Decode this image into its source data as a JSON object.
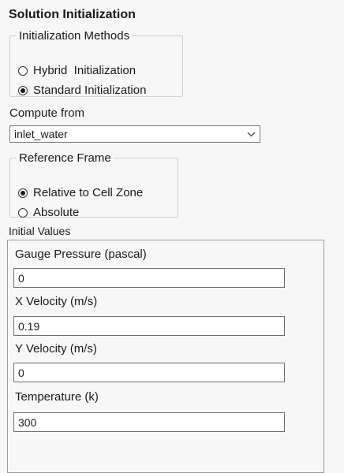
{
  "panel": {
    "title": "Solution Initialization"
  },
  "initialization_methods": {
    "legend": "Initialization Methods",
    "options": [
      {
        "label": "Hybrid  Initialization",
        "checked": false
      },
      {
        "label": "Standard Initialization",
        "checked": true
      }
    ]
  },
  "compute_from": {
    "label": "Compute from",
    "value": "inlet_water"
  },
  "reference_frame": {
    "legend": "Reference Frame",
    "options": [
      {
        "label": "Relative to Cell Zone",
        "checked": true
      },
      {
        "label": "Absolute",
        "checked": false
      }
    ]
  },
  "initial_values": {
    "label": "Initial Values",
    "fields": [
      {
        "label": "Gauge Pressure (pascal)",
        "value": "0"
      },
      {
        "label": "X Velocity (m/s)",
        "value": "0.19"
      },
      {
        "label": "Y Velocity (m/s)",
        "value": "0"
      },
      {
        "label": "Temperature (k)",
        "value": "300"
      }
    ]
  }
}
